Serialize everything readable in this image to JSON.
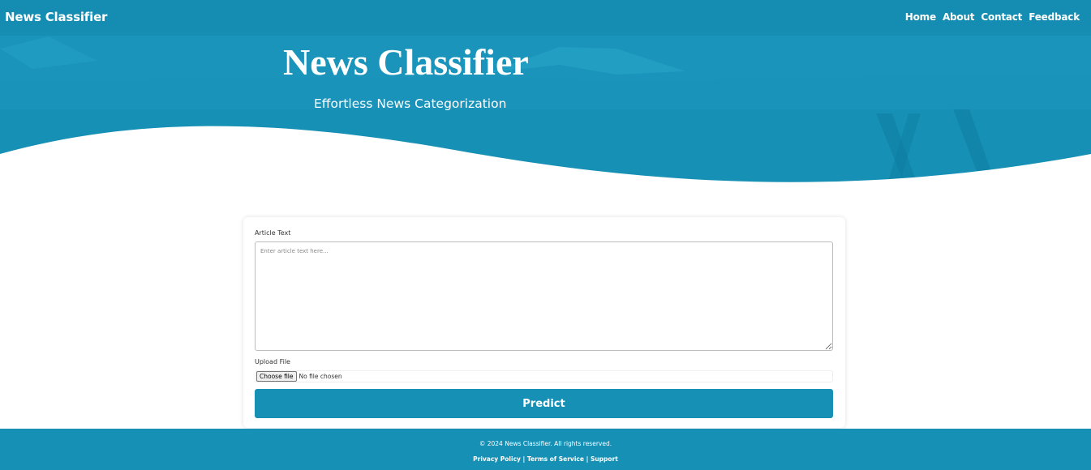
{
  "brand": "News Classifier",
  "nav": {
    "home": "Home",
    "about": "About",
    "contact": "Contact",
    "feedback": "Feedback"
  },
  "hero": {
    "title": "News Classifier",
    "subtitle": "Effortless News Categorization"
  },
  "form": {
    "article_label": "Article Text",
    "article_placeholder": "Enter article text here...",
    "upload_label": "Upload File",
    "choose_file": "Choose file",
    "file_status": "No file chosen",
    "predict": "Predict"
  },
  "footer": {
    "copyright": "© 2024 News Classifier. All rights reserved.",
    "privacy": "Privacy Policy",
    "separator": "|",
    "terms": "Terms of Service",
    "support": "Support"
  },
  "colors": {
    "primary": "#1790b5",
    "background": "#ffffff"
  }
}
